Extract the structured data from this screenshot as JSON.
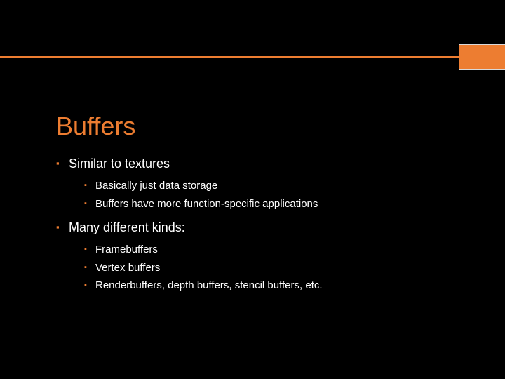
{
  "slide": {
    "title": "Buffers",
    "bullets": [
      {
        "text": "Similar to textures",
        "sub": [
          "Basically just data storage",
          "Buffers have more function-specific applications"
        ]
      },
      {
        "text": "Many different kinds:",
        "sub": [
          "Framebuffers",
          "Vertex buffers",
          "Renderbuffers, depth buffers, stencil buffers, etc."
        ]
      }
    ]
  }
}
